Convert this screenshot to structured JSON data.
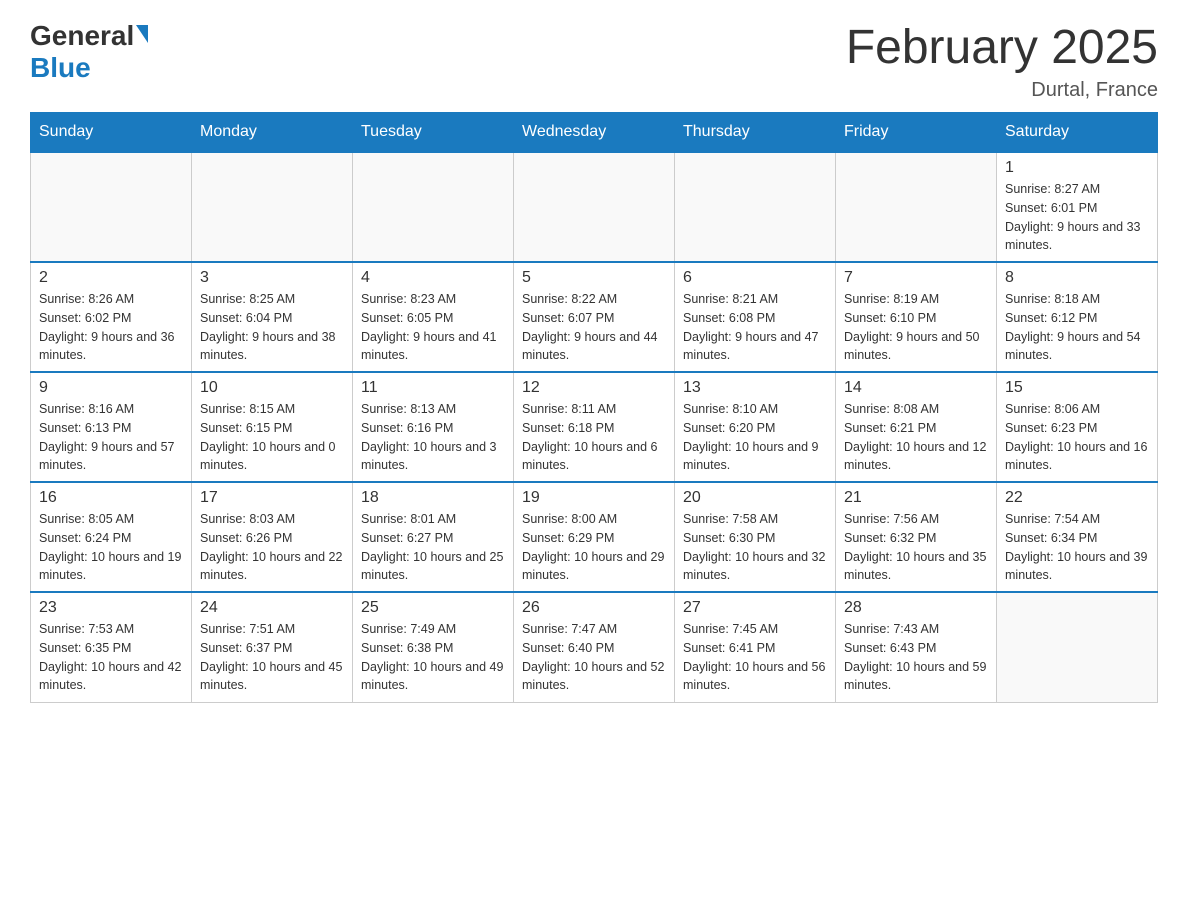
{
  "logo": {
    "general": "General",
    "blue": "Blue"
  },
  "title": "February 2025",
  "location": "Durtal, France",
  "days_of_week": [
    "Sunday",
    "Monday",
    "Tuesday",
    "Wednesday",
    "Thursday",
    "Friday",
    "Saturday"
  ],
  "weeks": [
    [
      {
        "day": "",
        "info": ""
      },
      {
        "day": "",
        "info": ""
      },
      {
        "day": "",
        "info": ""
      },
      {
        "day": "",
        "info": ""
      },
      {
        "day": "",
        "info": ""
      },
      {
        "day": "",
        "info": ""
      },
      {
        "day": "1",
        "info": "Sunrise: 8:27 AM\nSunset: 6:01 PM\nDaylight: 9 hours and 33 minutes."
      }
    ],
    [
      {
        "day": "2",
        "info": "Sunrise: 8:26 AM\nSunset: 6:02 PM\nDaylight: 9 hours and 36 minutes."
      },
      {
        "day": "3",
        "info": "Sunrise: 8:25 AM\nSunset: 6:04 PM\nDaylight: 9 hours and 38 minutes."
      },
      {
        "day": "4",
        "info": "Sunrise: 8:23 AM\nSunset: 6:05 PM\nDaylight: 9 hours and 41 minutes."
      },
      {
        "day": "5",
        "info": "Sunrise: 8:22 AM\nSunset: 6:07 PM\nDaylight: 9 hours and 44 minutes."
      },
      {
        "day": "6",
        "info": "Sunrise: 8:21 AM\nSunset: 6:08 PM\nDaylight: 9 hours and 47 minutes."
      },
      {
        "day": "7",
        "info": "Sunrise: 8:19 AM\nSunset: 6:10 PM\nDaylight: 9 hours and 50 minutes."
      },
      {
        "day": "8",
        "info": "Sunrise: 8:18 AM\nSunset: 6:12 PM\nDaylight: 9 hours and 54 minutes."
      }
    ],
    [
      {
        "day": "9",
        "info": "Sunrise: 8:16 AM\nSunset: 6:13 PM\nDaylight: 9 hours and 57 minutes."
      },
      {
        "day": "10",
        "info": "Sunrise: 8:15 AM\nSunset: 6:15 PM\nDaylight: 10 hours and 0 minutes."
      },
      {
        "day": "11",
        "info": "Sunrise: 8:13 AM\nSunset: 6:16 PM\nDaylight: 10 hours and 3 minutes."
      },
      {
        "day": "12",
        "info": "Sunrise: 8:11 AM\nSunset: 6:18 PM\nDaylight: 10 hours and 6 minutes."
      },
      {
        "day": "13",
        "info": "Sunrise: 8:10 AM\nSunset: 6:20 PM\nDaylight: 10 hours and 9 minutes."
      },
      {
        "day": "14",
        "info": "Sunrise: 8:08 AM\nSunset: 6:21 PM\nDaylight: 10 hours and 12 minutes."
      },
      {
        "day": "15",
        "info": "Sunrise: 8:06 AM\nSunset: 6:23 PM\nDaylight: 10 hours and 16 minutes."
      }
    ],
    [
      {
        "day": "16",
        "info": "Sunrise: 8:05 AM\nSunset: 6:24 PM\nDaylight: 10 hours and 19 minutes."
      },
      {
        "day": "17",
        "info": "Sunrise: 8:03 AM\nSunset: 6:26 PM\nDaylight: 10 hours and 22 minutes."
      },
      {
        "day": "18",
        "info": "Sunrise: 8:01 AM\nSunset: 6:27 PM\nDaylight: 10 hours and 25 minutes."
      },
      {
        "day": "19",
        "info": "Sunrise: 8:00 AM\nSunset: 6:29 PM\nDaylight: 10 hours and 29 minutes."
      },
      {
        "day": "20",
        "info": "Sunrise: 7:58 AM\nSunset: 6:30 PM\nDaylight: 10 hours and 32 minutes."
      },
      {
        "day": "21",
        "info": "Sunrise: 7:56 AM\nSunset: 6:32 PM\nDaylight: 10 hours and 35 minutes."
      },
      {
        "day": "22",
        "info": "Sunrise: 7:54 AM\nSunset: 6:34 PM\nDaylight: 10 hours and 39 minutes."
      }
    ],
    [
      {
        "day": "23",
        "info": "Sunrise: 7:53 AM\nSunset: 6:35 PM\nDaylight: 10 hours and 42 minutes."
      },
      {
        "day": "24",
        "info": "Sunrise: 7:51 AM\nSunset: 6:37 PM\nDaylight: 10 hours and 45 minutes."
      },
      {
        "day": "25",
        "info": "Sunrise: 7:49 AM\nSunset: 6:38 PM\nDaylight: 10 hours and 49 minutes."
      },
      {
        "day": "26",
        "info": "Sunrise: 7:47 AM\nSunset: 6:40 PM\nDaylight: 10 hours and 52 minutes."
      },
      {
        "day": "27",
        "info": "Sunrise: 7:45 AM\nSunset: 6:41 PM\nDaylight: 10 hours and 56 minutes."
      },
      {
        "day": "28",
        "info": "Sunrise: 7:43 AM\nSunset: 6:43 PM\nDaylight: 10 hours and 59 minutes."
      },
      {
        "day": "",
        "info": ""
      }
    ]
  ]
}
